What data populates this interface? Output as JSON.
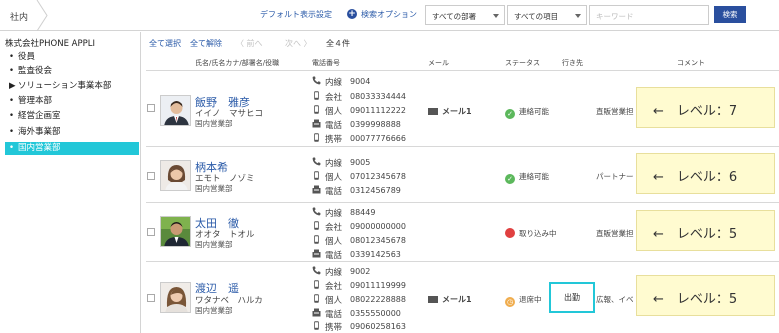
{
  "topbar": {
    "breadcrumb": "社内",
    "default_view": "デフォルト表示設定",
    "search_options": "検索オプション",
    "dept_select": "すべての部署",
    "field_select": "すべての項目",
    "keyword_placeholder": "キーワード",
    "search_button": "検索"
  },
  "sidebar": {
    "company": "株式会社PHONE APPLI",
    "items": [
      {
        "marker": "•",
        "label": "役員"
      },
      {
        "marker": "•",
        "label": "監査役会"
      },
      {
        "marker": "▶",
        "label": "ソリューション事業本部"
      },
      {
        "marker": "•",
        "label": "管理本部"
      },
      {
        "marker": "•",
        "label": "経営企画室"
      },
      {
        "marker": "•",
        "label": "海外事業部"
      },
      {
        "marker": "•",
        "label": "国内営業部"
      }
    ]
  },
  "toolbar": {
    "select_all": "全て選択",
    "deselect_all": "全て解除",
    "prev": "〈 前へ",
    "next": "次へ 〉",
    "count": "全４件"
  },
  "table": {
    "headers": {
      "name": "氏名/氏名カナ/部署名/役職",
      "phone": "電話番号",
      "mail": "メール",
      "status": "ステータス",
      "destination": "行き先",
      "comment": "コメント"
    },
    "rows": [
      {
        "name": "飯野　雅彦",
        "kana": "イイノ　マサヒコ",
        "dept": "国内営業部",
        "phones": [
          {
            "icon": "phone-icon",
            "label": "内線",
            "number": "9004"
          },
          {
            "icon": "mobile-icon",
            "label": "会社",
            "number": "08033334444"
          },
          {
            "icon": "mobile-icon",
            "label": "個人",
            "number": "09011112222"
          },
          {
            "icon": "fax-icon",
            "label": "電話",
            "number": "0399998888"
          },
          {
            "icon": "mobile-icon",
            "label": "携帯",
            "number": "00077776666"
          }
        ],
        "mail": "メール1",
        "status": "連絡可能",
        "status_color": "#5cb85c",
        "destination": "",
        "comment": "直販営業担",
        "callout": "←　レベル：7"
      },
      {
        "name": "柄本希",
        "kana": "エモト　ノゾミ",
        "dept": "国内営業部",
        "phones": [
          {
            "icon": "phone-icon",
            "label": "内線",
            "number": "9005"
          },
          {
            "icon": "mobile-icon",
            "label": "個人",
            "number": "07012345678"
          },
          {
            "icon": "fax-icon",
            "label": "電話",
            "number": "0312456789"
          }
        ],
        "mail": "",
        "status": "連絡可能",
        "status_color": "#5cb85c",
        "destination": "",
        "comment": "パートナー",
        "callout": "←　レベル：6"
      },
      {
        "name": "太田　徹",
        "kana": "オオタ　トオル",
        "dept": "国内営業部",
        "phones": [
          {
            "icon": "phone-icon",
            "label": "内線",
            "number": "88449"
          },
          {
            "icon": "mobile-icon",
            "label": "会社",
            "number": "09000000000"
          },
          {
            "icon": "mobile-icon",
            "label": "個人",
            "number": "08012345678"
          },
          {
            "icon": "fax-icon",
            "label": "電話",
            "number": "0339142563"
          }
        ],
        "mail": "",
        "status": "取り込み中",
        "status_color": "#e04040",
        "destination": "",
        "comment": "直販営業担",
        "callout": "←　レベル：5"
      },
      {
        "name": "渡辺　遥",
        "kana": "ワタナベ　ハルカ",
        "dept": "国内営業部",
        "phones": [
          {
            "icon": "phone-icon",
            "label": "内線",
            "number": "9002"
          },
          {
            "icon": "mobile-icon",
            "label": "会社",
            "number": "09011119999"
          },
          {
            "icon": "mobile-icon",
            "label": "個人",
            "number": "08022228888"
          },
          {
            "icon": "fax-icon",
            "label": "電話",
            "number": "0355550000"
          },
          {
            "icon": "mobile-icon",
            "label": "携帯",
            "number": "09060258163"
          }
        ],
        "mail": "メール1",
        "status": "退席中",
        "status_color": "#f0ad4e",
        "destination": "出勤",
        "comment": "広報、イベ",
        "callout": "←　レベル：5"
      }
    ]
  }
}
